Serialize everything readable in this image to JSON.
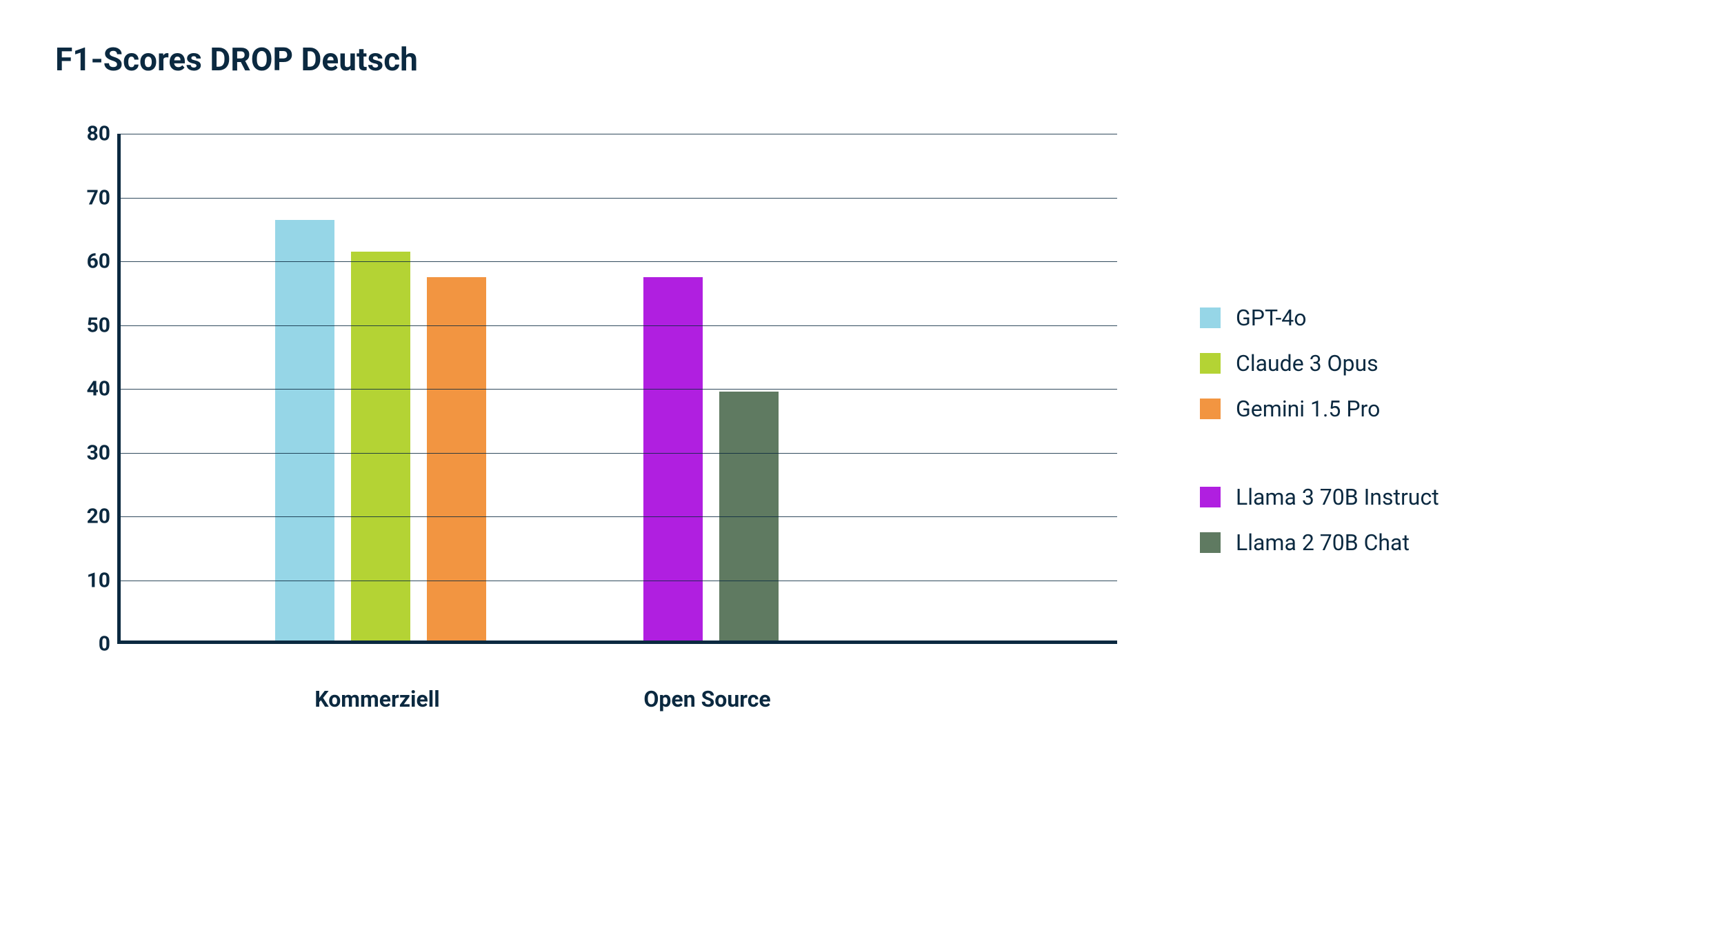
{
  "chart_data": {
    "type": "bar",
    "title": "F1-Scores DROP Deutsch",
    "ylim": [
      0,
      80
    ],
    "yticks": [
      0,
      10,
      20,
      30,
      40,
      50,
      60,
      70,
      80
    ],
    "categories": [
      "Kommerziell",
      "Open Source"
    ],
    "series": [
      {
        "name": "GPT-4o",
        "color": "#96d6e7",
        "values": [
          66,
          null
        ]
      },
      {
        "name": "Claude 3 Opus",
        "color": "#b4d334",
        "values": [
          61,
          null
        ]
      },
      {
        "name": "Gemini 1.5 Pro",
        "color": "#f29541",
        "values": [
          57,
          null
        ]
      },
      {
        "name": "Llama 3 70B Instruct",
        "color": "#b01fe0",
        "values": [
          null,
          57
        ]
      },
      {
        "name": "Llama 2 70B Chat",
        "color": "#5f7a61",
        "values": [
          null,
          39
        ]
      }
    ],
    "legend_groups": [
      [
        "GPT-4o",
        "Claude 3 Opus",
        "Gemini 1.5 Pro"
      ],
      [
        "Llama 3 70B Instruct",
        "Llama 2 70B Chat"
      ]
    ]
  }
}
